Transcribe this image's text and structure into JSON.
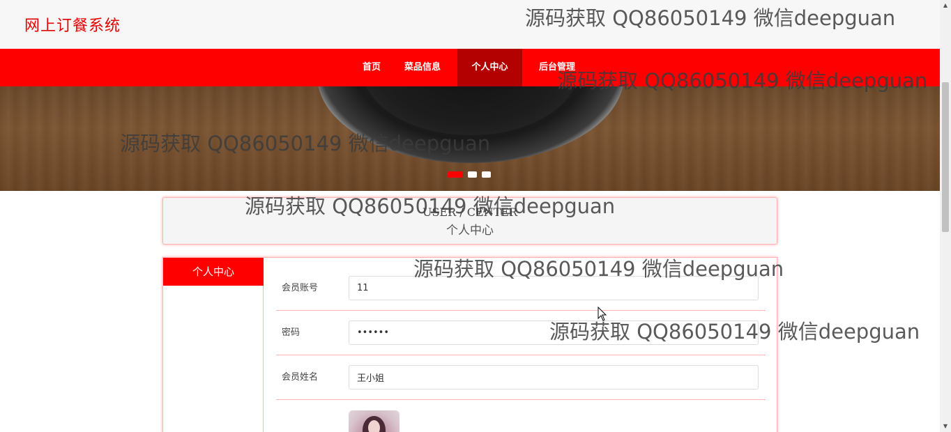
{
  "header": {
    "site_title": "网上订餐系统"
  },
  "nav": {
    "items": [
      {
        "label": "首页"
      },
      {
        "label": "菜品信息"
      },
      {
        "label": "个人中心",
        "active": true
      },
      {
        "label": "后台管理"
      }
    ]
  },
  "banner": {
    "slides": 3,
    "active_slide": 1
  },
  "page_title": {
    "en": "USER / CENTER",
    "cn": "个人中心"
  },
  "sidebar": {
    "heading": "个人中心"
  },
  "form": {
    "account": {
      "label": "会员账号",
      "value": "11"
    },
    "password": {
      "label": "密码",
      "value": "••••••"
    },
    "name": {
      "label": "会员姓名",
      "value": "王小姐"
    }
  },
  "watermark": {
    "text": "源码获取 QQ86050149 微信deepguan"
  },
  "colors": {
    "primary": "#ff0000",
    "nav_active": "#b30000",
    "border": "#ffb3b3"
  }
}
